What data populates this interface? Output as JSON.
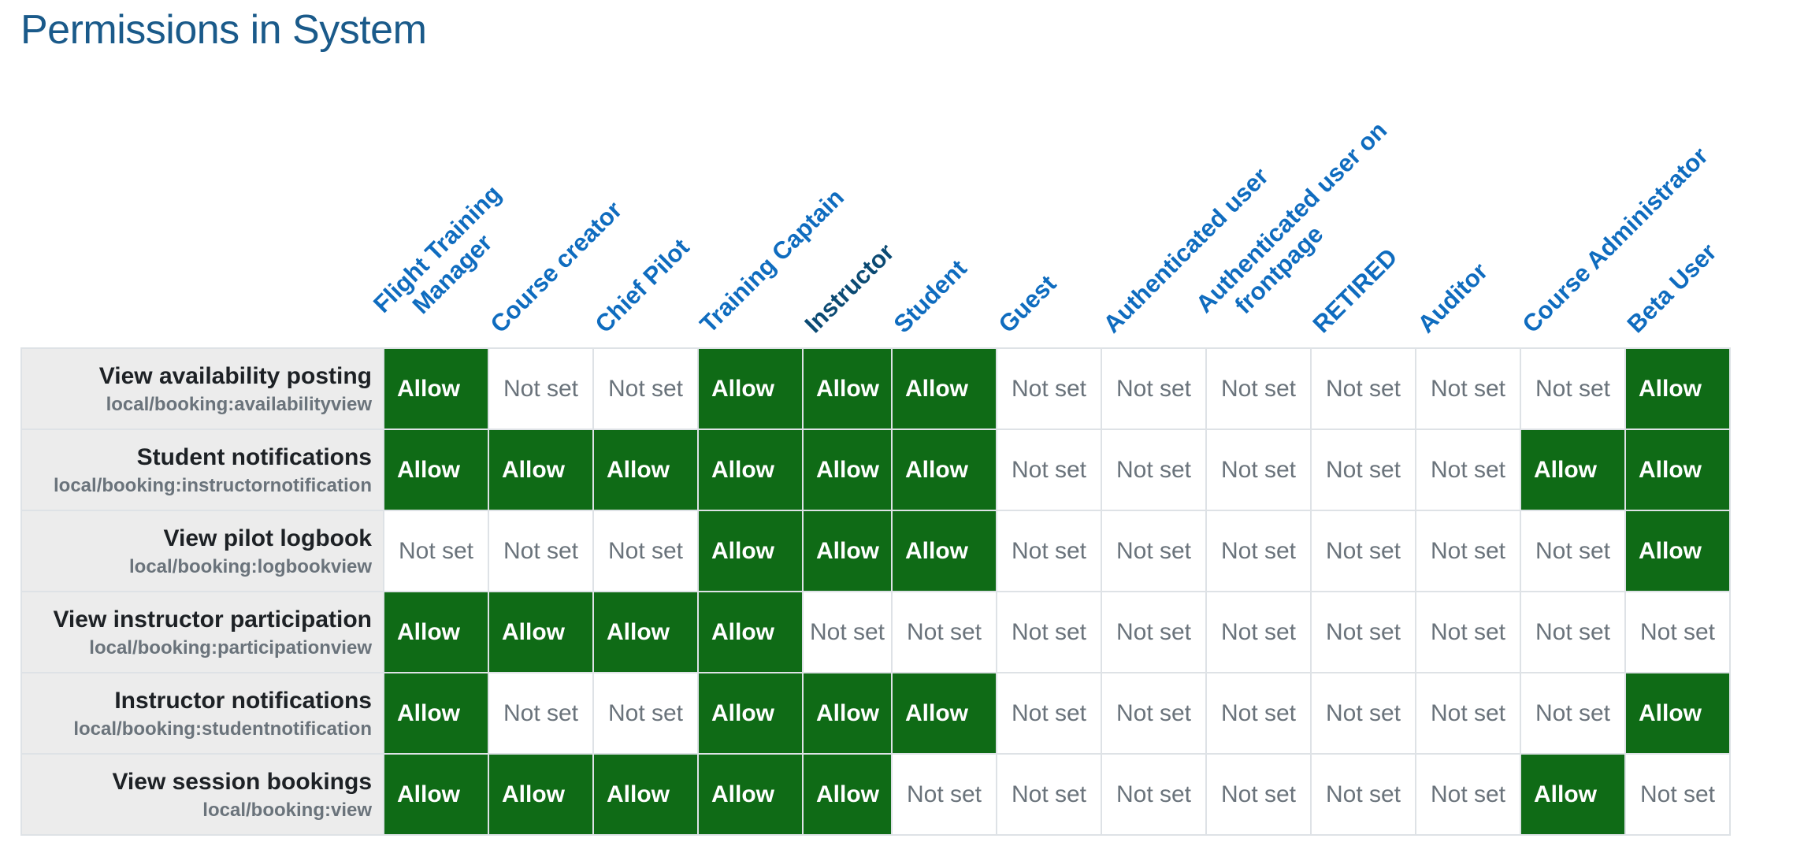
{
  "page": {
    "title": "Permissions in System"
  },
  "roles": [
    {
      "line1": "Flight Training",
      "line2": "Manager"
    },
    {
      "line1": "Course creator",
      "line2": ""
    },
    {
      "line1": "Chief Pilot",
      "line2": ""
    },
    {
      "line1": "Training Captain",
      "line2": ""
    },
    {
      "line1": "Instructor",
      "line2": ""
    },
    {
      "line1": "Student",
      "line2": ""
    },
    {
      "line1": "Guest",
      "line2": ""
    },
    {
      "line1": "Authenticated user",
      "line2": ""
    },
    {
      "line1": "Authenticated user on",
      "line2": "frontpage"
    },
    {
      "line1": "RETIRED",
      "line2": ""
    },
    {
      "line1": "Auditor",
      "line2": ""
    },
    {
      "line1": "Course Administrator",
      "line2": ""
    },
    {
      "line1": "Beta User",
      "line2": ""
    }
  ],
  "capabilities": [
    {
      "name": "View availability posting",
      "id": "local/booking:availabilityview",
      "values": [
        "Allow",
        "Not set",
        "Not set",
        "Allow",
        "Allow",
        "Allow",
        "Not set",
        "Not set",
        "Not set",
        "Not set",
        "Not set",
        "Not set",
        "Allow"
      ]
    },
    {
      "name": "Student notifications",
      "id": "local/booking:instructornotification",
      "values": [
        "Allow",
        "Allow",
        "Allow",
        "Allow",
        "Allow",
        "Allow",
        "Not set",
        "Not set",
        "Not set",
        "Not set",
        "Not set",
        "Allow",
        "Allow"
      ]
    },
    {
      "name": "View pilot logbook",
      "id": "local/booking:logbookview",
      "values": [
        "Not set",
        "Not set",
        "Not set",
        "Allow",
        "Allow",
        "Allow",
        "Not set",
        "Not set",
        "Not set",
        "Not set",
        "Not set",
        "Not set",
        "Allow"
      ]
    },
    {
      "name": "View instructor participation",
      "id": "local/booking:participationview",
      "values": [
        "Allow",
        "Allow",
        "Allow",
        "Allow",
        "Not set",
        "Not set",
        "Not set",
        "Not set",
        "Not set",
        "Not set",
        "Not set",
        "Not set",
        "Not set"
      ]
    },
    {
      "name": "Instructor notifications",
      "id": "local/booking:studentnotification",
      "values": [
        "Allow",
        "Not set",
        "Not set",
        "Allow",
        "Allow",
        "Allow",
        "Not set",
        "Not set",
        "Not set",
        "Not set",
        "Not set",
        "Not set",
        "Allow"
      ]
    },
    {
      "name": "View session bookings",
      "id": "local/booking:view",
      "values": [
        "Allow",
        "Allow",
        "Allow",
        "Allow",
        "Allow",
        "Not set",
        "Not set",
        "Not set",
        "Not set",
        "Not set",
        "Not set",
        "Allow",
        "Not set"
      ]
    }
  ],
  "colors": {
    "allow_bg": "#0f6b16",
    "link": "#0f6cbf",
    "title": "#1a5a8a"
  }
}
